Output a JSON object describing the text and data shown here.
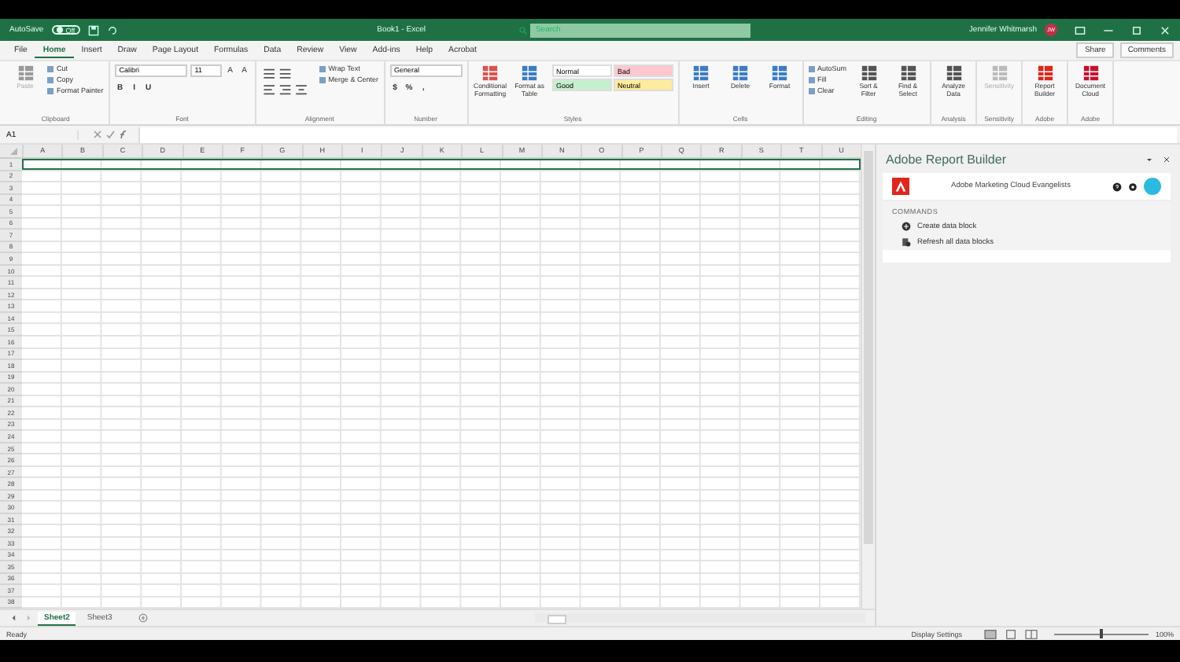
{
  "title_bar": {
    "autosave_label": "AutoSave",
    "autosave": {
      "on": false,
      "label": "Off"
    },
    "title": "Book1 - Excel",
    "search": {
      "placeholder": "Search"
    },
    "user": "Jennifer Whitmarsh",
    "avatar": "JW"
  },
  "tabs": [
    {
      "label": "File",
      "selected": false
    },
    {
      "label": "Home",
      "selected": true
    },
    {
      "label": "Insert",
      "selected": false
    },
    {
      "label": "Draw",
      "selected": false
    },
    {
      "label": "Page Layout",
      "selected": false
    },
    {
      "label": "Formulas",
      "selected": false
    },
    {
      "label": "Data",
      "selected": false
    },
    {
      "label": "Review",
      "selected": false
    },
    {
      "label": "View",
      "selected": false
    },
    {
      "label": "Add-ins",
      "selected": false
    },
    {
      "label": "Help",
      "selected": false
    },
    {
      "label": "Acrobat",
      "selected": false
    }
  ],
  "share": "Share",
  "comments": "Comments",
  "ribbon": [
    {
      "label": "Clipboard",
      "items": [
        {
          "kind": "large",
          "label": "Paste",
          "disabled": true,
          "color": "#9a9a9a"
        },
        {
          "kind": "stack",
          "labels": [
            "Cut",
            "Copy",
            "Format Painter"
          ]
        }
      ]
    },
    {
      "label": "Font",
      "items": [
        {
          "kind": "fields",
          "fields": [
            "Calibri",
            "11"
          ],
          "glyphs": [
            "A",
            "A"
          ]
        },
        {
          "kind": "font_styles",
          "glyphs": [
            "B",
            "I",
            "U"
          ]
        }
      ]
    },
    {
      "label": "Alignment",
      "items": [
        {
          "kind": "aligns"
        },
        {
          "kind": "stack",
          "labels": [
            "Wrap Text",
            "Merge & Center"
          ]
        }
      ]
    },
    {
      "label": "Number",
      "items": [
        {
          "kind": "fields",
          "fields": [
            "General"
          ]
        },
        {
          "kind": "number_formats",
          "glyphs": [
            "$",
            "%",
            ","
          ]
        }
      ]
    },
    {
      "label": "Styles",
      "items": [
        {
          "kind": "large",
          "label": "Conditional Formatting",
          "disabled": false,
          "color": "#d9534f"
        },
        {
          "kind": "large",
          "label": "Format as Table",
          "disabled": false,
          "color": "#3b7dc4"
        },
        {
          "kind": "styles",
          "cells": [
            {
              "label": "Normal",
              "color": "#ffffff"
            },
            {
              "label": "Bad",
              "color": "#ffc7ce"
            },
            {
              "label": "Good",
              "color": "#c6efce"
            },
            {
              "label": "Neutral",
              "color": "#ffeb9c"
            }
          ]
        }
      ]
    },
    {
      "label": "Cells",
      "items": [
        {
          "kind": "large",
          "label": "Insert",
          "disabled": false,
          "color": "#3b7dc4"
        },
        {
          "kind": "large",
          "label": "Delete",
          "disabled": false,
          "color": "#3b7dc4"
        },
        {
          "kind": "large",
          "label": "Format",
          "disabled": false,
          "color": "#3b7dc4"
        }
      ]
    },
    {
      "label": "Editing",
      "items": [
        {
          "kind": "stack",
          "labels": [
            "AutoSum",
            "Fill",
            "Clear"
          ]
        },
        {
          "kind": "large",
          "label": "Sort & Filter",
          "disabled": false,
          "color": "#555555"
        },
        {
          "kind": "large",
          "label": "Find & Select",
          "disabled": false,
          "color": "#555555"
        }
      ]
    },
    {
      "label": "Analysis",
      "items": [
        {
          "kind": "large",
          "label": "Analyze Data",
          "disabled": false,
          "color": "#555555"
        }
      ]
    },
    {
      "label": "Sensitivity",
      "items": [
        {
          "kind": "large",
          "label": "Sensitivity",
          "disabled": true,
          "color": "#bbbbbb"
        }
      ]
    },
    {
      "label": "Adobe",
      "items": [
        {
          "kind": "large",
          "label": "Report Builder",
          "disabled": false,
          "color": "#e0261b"
        }
      ]
    },
    {
      "label": "Adobe",
      "items": [
        {
          "kind": "large",
          "label": "Document Cloud",
          "disabled": false,
          "color": "#c8102e"
        }
      ]
    }
  ],
  "name_box": "A1",
  "columns": [
    "A",
    "B",
    "C",
    "D",
    "E",
    "F",
    "G",
    "H",
    "I",
    "J",
    "K",
    "L",
    "M",
    "N",
    "O",
    "P",
    "Q",
    "R",
    "S",
    "T",
    "U"
  ],
  "rows": [
    "1",
    "2",
    "3",
    "4",
    "5",
    "6",
    "7",
    "8",
    "9",
    "10",
    "11",
    "12",
    "13",
    "14",
    "15",
    "16",
    "17",
    "18",
    "19",
    "20",
    "21",
    "22",
    "23",
    "24",
    "25",
    "26",
    "27",
    "28",
    "29",
    "30",
    "31",
    "32",
    "33",
    "34",
    "35",
    "36",
    "37",
    "38"
  ],
  "pane": {
    "title": "Adobe Report Builder",
    "account": "Adobe Marketing Cloud Evangelists",
    "section": "COMMANDS",
    "commands": [
      "Create data block",
      "Refresh all data blocks"
    ]
  },
  "sheets": [
    {
      "label": "Sheet2",
      "selected": true
    },
    {
      "label": "Sheet3",
      "selected": false
    }
  ],
  "status_bar": {
    "status": "Ready",
    "display_settings": "Display Settings",
    "zoom": {
      "level": 0.5,
      "label": "100%"
    }
  }
}
